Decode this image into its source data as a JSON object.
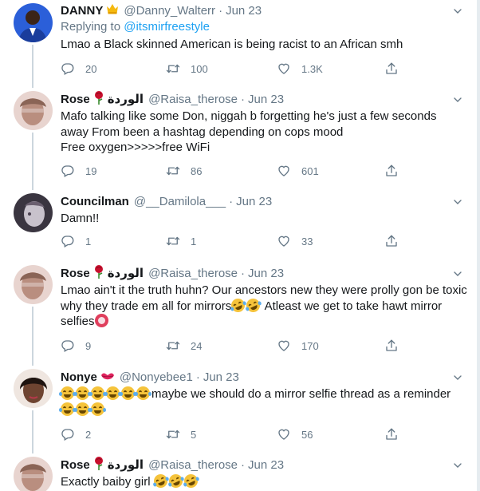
{
  "tweets": [
    {
      "name": "DANNY",
      "name_emoji": "crown-icon",
      "handle": "@Danny_Walterr",
      "dot": "·",
      "time": "Jun 23",
      "reply_prefix": "Replying to ",
      "reply_mention": "@itsmirfreestyle",
      "lines": [
        "Lmao a Black skinned American is being racist to an African smh"
      ],
      "replies": "20",
      "retweets": "100",
      "likes": "1.3K"
    },
    {
      "name": "Rose",
      "name_emoji": "rose-icon",
      "name_suffix": "الوردة",
      "handle": "@Raisa_therose",
      "dot": "·",
      "time": "Jun 23",
      "lines": [
        "Mafo talking like some Don, niggah b forgetting he's just a few seconds",
        "away From been a hashtag depending on cops mood",
        "Free oxygen>>>>>free WiFi"
      ],
      "replies": "19",
      "retweets": "86",
      "likes": "601"
    },
    {
      "name": "Councilman",
      "handle": "@__Damilola___",
      "dot": "·",
      "time": "Jun 23",
      "lines": [
        "Damn!!"
      ],
      "replies": "1",
      "retweets": "1",
      "likes": "33"
    },
    {
      "name": "Rose",
      "name_emoji": "rose-icon",
      "name_suffix": "الوردة",
      "handle": "@Raisa_therose",
      "dot": "·",
      "time": "Jun 23",
      "lines": [
        "Lmao ain't it the truth huhn? Our ancestors new they were prolly gon be toxic",
        "why they trade em all for mirrors",
        " Atleast we get to take hawt mirror",
        "selfies"
      ],
      "replies": "9",
      "retweets": "24",
      "likes": "170"
    },
    {
      "name": "Nonye",
      "name_emoji": "kiss-icon",
      "handle": "@Nonyebee1",
      "dot": "·",
      "time": "Jun 23",
      "lines": [
        "maybe we should do a mirror selfie thread as a reminder"
      ],
      "replies": "2",
      "retweets": "5",
      "likes": "56"
    },
    {
      "name": "Rose",
      "name_emoji": "rose-icon",
      "name_suffix": "الوردة",
      "handle": "@Raisa_therose",
      "dot": "·",
      "time": "Jun 23",
      "lines": [
        "Exactly baiby girl"
      ]
    }
  ],
  "colors": {
    "text": "#14171a",
    "muted": "#657786",
    "accent": "#1da1f2",
    "thread": "#ccd6dd"
  }
}
